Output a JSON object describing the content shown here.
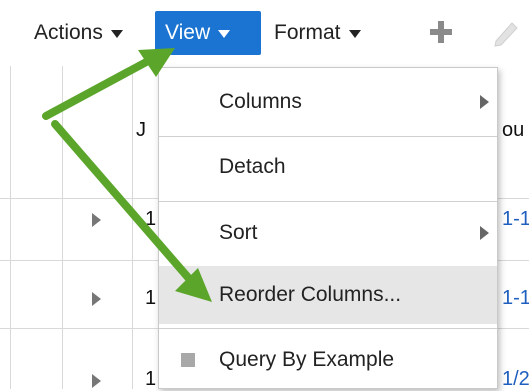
{
  "toolbar": {
    "actions_label": "Actions",
    "view_label": "View",
    "format_label": "Format",
    "add_icon": "plus-icon",
    "edit_icon": "pencil-icon"
  },
  "table": {
    "header_partial_left": "J",
    "header_partial_right": "ou",
    "rows": [
      {
        "left": "1",
        "right": "1-1"
      },
      {
        "left": "1",
        "right": "1-1"
      },
      {
        "left": "1",
        "right": "1/2"
      }
    ]
  },
  "view_menu": {
    "items": [
      {
        "label": "Columns",
        "has_submenu": true
      },
      {
        "label": "Detach",
        "has_submenu": false
      },
      {
        "label": "Sort",
        "has_submenu": true
      },
      {
        "label": "Reorder Columns...",
        "has_submenu": false,
        "highlighted": true
      },
      {
        "label": "Query By Example",
        "has_submenu": false,
        "checkbox": true
      }
    ]
  },
  "colors": {
    "active_menu": "#1b74d1",
    "annotation_arrow": "#5aa52a",
    "highlight": "#e6e6e6"
  }
}
